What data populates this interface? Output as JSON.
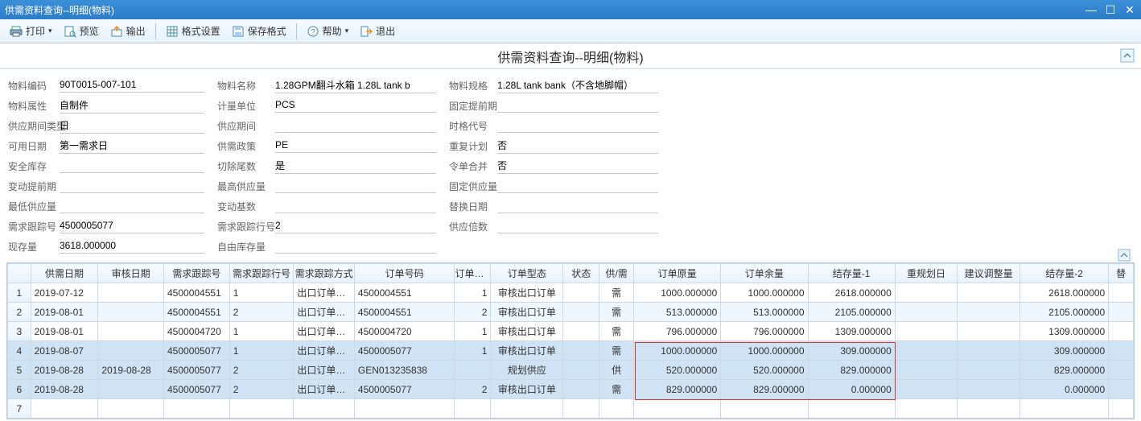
{
  "window": {
    "title": "供需资料查询--明细(物料)"
  },
  "toolbar": {
    "print": "打印",
    "preview": "预览",
    "export": "输出",
    "format_set": "格式设置",
    "save_format": "保存格式",
    "help": "帮助",
    "exit": "退出"
  },
  "page": {
    "title": "供需资料查询--明细(物料)"
  },
  "form": {
    "col1": {
      "f1": {
        "label": "物料编码",
        "value": "90T0015-007-101"
      },
      "f2": {
        "label": "物料属性",
        "value": "自制件"
      },
      "f3": {
        "label": "供应期间类型",
        "value": "日"
      },
      "f4": {
        "label": "可用日期",
        "value": "第一需求日"
      },
      "f5": {
        "label": "安全库存",
        "value": ""
      },
      "f6": {
        "label": "变动提前期",
        "value": ""
      },
      "f7": {
        "label": "最低供应量",
        "value": ""
      },
      "f8": {
        "label": "需求跟踪号",
        "value": "4500005077"
      },
      "f9": {
        "label": "现存量",
        "value": "3618.000000"
      }
    },
    "col2": {
      "f1": {
        "label": "物料名称",
        "value": "1.28GPM翻斗水箱 1.28L tank b"
      },
      "f2": {
        "label": "计量单位",
        "value": "PCS"
      },
      "f3": {
        "label": "供应期间",
        "value": ""
      },
      "f4": {
        "label": "供需政策",
        "value": "PE"
      },
      "f5": {
        "label": "切除尾数",
        "value": "是"
      },
      "f6": {
        "label": "最高供应量",
        "value": ""
      },
      "f7": {
        "label": "变动基数",
        "value": ""
      },
      "f8": {
        "label": "需求跟踪行号",
        "value": "2"
      },
      "f9": {
        "label": "自由库存量",
        "value": ""
      }
    },
    "col3": {
      "f1": {
        "label": "物料规格",
        "value": "1.28L tank bank（不含地脚帽）"
      },
      "f2": {
        "label": "固定提前期",
        "value": ""
      },
      "f3": {
        "label": "时格代号",
        "value": ""
      },
      "f4": {
        "label": "重复计划",
        "value": "否"
      },
      "f5": {
        "label": "令单合并",
        "value": "否"
      },
      "f6": {
        "label": "固定供应量",
        "value": ""
      },
      "f7": {
        "label": "替换日期",
        "value": ""
      },
      "f8": {
        "label": "供应倍数",
        "value": ""
      }
    }
  },
  "grid": {
    "columns": [
      "供需日期",
      "审核日期",
      "需求跟踪号",
      "需求跟踪行号",
      "需求跟踪方式",
      "订单号码",
      "订单行号",
      "订单型态",
      "状态",
      "供/需",
      "订单原量",
      "订单余量",
      "结存量-1",
      "重规划日",
      "建议调整量",
      "结存量-2",
      "替"
    ],
    "rows": [
      {
        "rn": "1",
        "sel": false,
        "c": [
          "2019-07-12",
          "",
          "4500004551",
          "1",
          "出口订单行号",
          "4500004551",
          "1",
          "审核出口订单",
          "",
          "需",
          "1000.000000",
          "1000.000000",
          "2618.000000",
          "",
          "",
          "2618.000000",
          ""
        ]
      },
      {
        "rn": "2",
        "sel": false,
        "c": [
          "2019-08-01",
          "",
          "4500004551",
          "2",
          "出口订单行号",
          "4500004551",
          "2",
          "审核出口订单",
          "",
          "需",
          "513.000000",
          "513.000000",
          "2105.000000",
          "",
          "",
          "2105.000000",
          ""
        ]
      },
      {
        "rn": "3",
        "sel": false,
        "c": [
          "2019-08-01",
          "",
          "4500004720",
          "1",
          "出口订单行号",
          "4500004720",
          "1",
          "审核出口订单",
          "",
          "需",
          "796.000000",
          "796.000000",
          "1309.000000",
          "",
          "",
          "1309.000000",
          ""
        ]
      },
      {
        "rn": "4",
        "sel": true,
        "c": [
          "2019-08-07",
          "",
          "4500005077",
          "1",
          "出口订单行号",
          "4500005077",
          "1",
          "审核出口订单",
          "",
          "需",
          "1000.000000",
          "1000.000000",
          "309.000000",
          "",
          "",
          "309.000000",
          ""
        ]
      },
      {
        "rn": "5",
        "sel": true,
        "c": [
          "2019-08-28",
          "2019-08-28",
          "4500005077",
          "2",
          "出口订单行号",
          "GEN013235838",
          "",
          "规划供应",
          "",
          "供",
          "520.000000",
          "520.000000",
          "829.000000",
          "",
          "",
          "829.000000",
          ""
        ]
      },
      {
        "rn": "6",
        "sel": true,
        "c": [
          "2019-08-28",
          "",
          "4500005077",
          "2",
          "出口订单行号",
          "4500005077",
          "2",
          "审核出口订单",
          "",
          "需",
          "829.000000",
          "829.000000",
          "0.000000",
          "",
          "",
          "0.000000",
          ""
        ]
      },
      {
        "rn": "7",
        "sel": false,
        "c": [
          "",
          "",
          "",
          "",
          "",
          "",
          "",
          "",
          "",
          "",
          "",
          "",
          "",
          "",
          "",
          "",
          ""
        ]
      }
    ]
  }
}
